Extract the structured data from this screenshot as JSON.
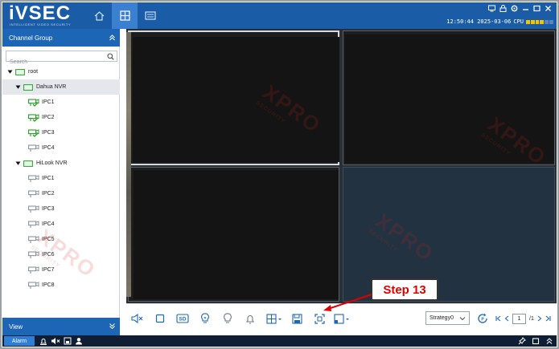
{
  "app": {
    "logo": "iVSEC",
    "logo_tagline": "INTELLIGENT VIDEO SECURITY",
    "datetime": "12:50:44 2025-03-06",
    "cpu_label": "CPU",
    "cpu_segments_on": 4,
    "cpu_segments_total": 6
  },
  "nav_tabs": [
    {
      "name": "home",
      "icon": "home-icon",
      "active": false
    },
    {
      "name": "live-view",
      "icon": "grid-icon",
      "active": true
    },
    {
      "name": "playback",
      "icon": "film-icon",
      "active": false
    }
  ],
  "window_controls": [
    "monitor-icon",
    "lock-icon",
    "gear-icon",
    "minimize-icon",
    "maximize-icon",
    "close-icon"
  ],
  "sidebar": {
    "header": "Channel Group",
    "search_placeholder": "Search",
    "tree": [
      {
        "level": 0,
        "label": "root",
        "type": "group",
        "expanded": true
      },
      {
        "level": 1,
        "label": "Dahua NVR",
        "type": "nvr",
        "expanded": true,
        "selected": true
      },
      {
        "level": 2,
        "label": "IPC1",
        "type": "camera",
        "online": true
      },
      {
        "level": 2,
        "label": "IPC2",
        "type": "camera",
        "online": true
      },
      {
        "level": 2,
        "label": "IPC3",
        "type": "camera",
        "online": true
      },
      {
        "level": 2,
        "label": "IPC4",
        "type": "camera",
        "online": false
      },
      {
        "level": 1,
        "label": "HiLook NVR",
        "type": "nvr",
        "expanded": true,
        "selected": false
      },
      {
        "level": 2,
        "label": "IPC1",
        "type": "camera",
        "online": false
      },
      {
        "level": 2,
        "label": "IPC2",
        "type": "camera",
        "online": false
      },
      {
        "level": 2,
        "label": "IPC3",
        "type": "camera",
        "online": false
      },
      {
        "level": 2,
        "label": "IPC4",
        "type": "camera",
        "online": false
      },
      {
        "level": 2,
        "label": "IPC5",
        "type": "camera",
        "online": false
      },
      {
        "level": 2,
        "label": "IPC6",
        "type": "camera",
        "online": false
      },
      {
        "level": 2,
        "label": "IPC7",
        "type": "camera",
        "online": false
      },
      {
        "level": 2,
        "label": "IPC8",
        "type": "camera",
        "online": false
      }
    ],
    "view_header": "View"
  },
  "toolbar": {
    "buttons": [
      "mute-icon",
      "stop-icon",
      "sd-icon",
      "bulb-icon",
      "light-icon",
      "bell-icon",
      "layout-icon",
      "save-icon",
      "fullscreen-icon",
      "window-icon"
    ],
    "sd_label": "SD",
    "strategy_value": "Strategy0",
    "page_current": "1",
    "page_total": "/1"
  },
  "annotation": {
    "label": "Step 13"
  },
  "statusbar": {
    "alarm_label": "Alarm",
    "left_icons": [
      "alarm-bell-icon",
      "speaker-mute-icon",
      "screen-icon",
      "person-icon"
    ],
    "right_icons": [
      "pin-icon",
      "restore-icon",
      "collapse-icon"
    ]
  },
  "colors": {
    "brand_blue": "#1a5ca6",
    "panel_blue": "#1d66b6",
    "accent_blue": "#2e7ed8",
    "cpu_yellow": "#f4c400",
    "annotation_red": "#e00000"
  },
  "watermark": {
    "text": "XPRO",
    "subtext": "SECURITY"
  }
}
